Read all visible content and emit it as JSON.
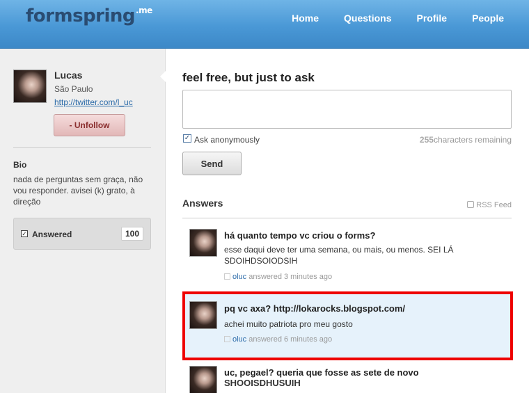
{
  "header": {
    "logo_text": "formspring",
    "logo_suffix": ".me",
    "nav": [
      "Home",
      "Questions",
      "Profile",
      "People"
    ]
  },
  "sidebar": {
    "name": "Lucas",
    "location": "São Paulo",
    "link": "http://twitter.com/l_uc",
    "unfollow_label": "- Unfollow",
    "bio_heading": "Bio",
    "bio_text": "nada de perguntas sem graça, não vou responder. avisei (k) grato, à direção",
    "answered_label": "Answered",
    "answered_count": "100"
  },
  "ask": {
    "title": "feel free, but just to ask",
    "anonymous_label": "Ask anonymously",
    "chars_count": "255",
    "chars_label": "characters remaining",
    "send_label": "Send"
  },
  "answers": {
    "heading": "Answers",
    "rss_label": "RSS Feed",
    "items": [
      {
        "question": "há quanto tempo vc criou o forms?",
        "answer": "esse daqui deve ter uma semana, ou mais, ou menos. SEI LÁ SDOIHDSOIODSIH",
        "user": "oluc",
        "time": "answered 3 minutes ago"
      },
      {
        "question": "pq vc axa? http://lokarocks.blogspot.com/",
        "answer": "achei muito patriota pro meu gosto",
        "user": "oluc",
        "time": "answered 6 minutes ago"
      },
      {
        "question": "uc, pegael? queria que fosse as sete de novo",
        "answer": "SHOOISDHUSUIH",
        "user": "",
        "time": ""
      }
    ]
  },
  "colors": {
    "header_blue": "#4a98d6",
    "highlight_border": "#ee0000",
    "highlight_bg": "#e6f2fb"
  }
}
